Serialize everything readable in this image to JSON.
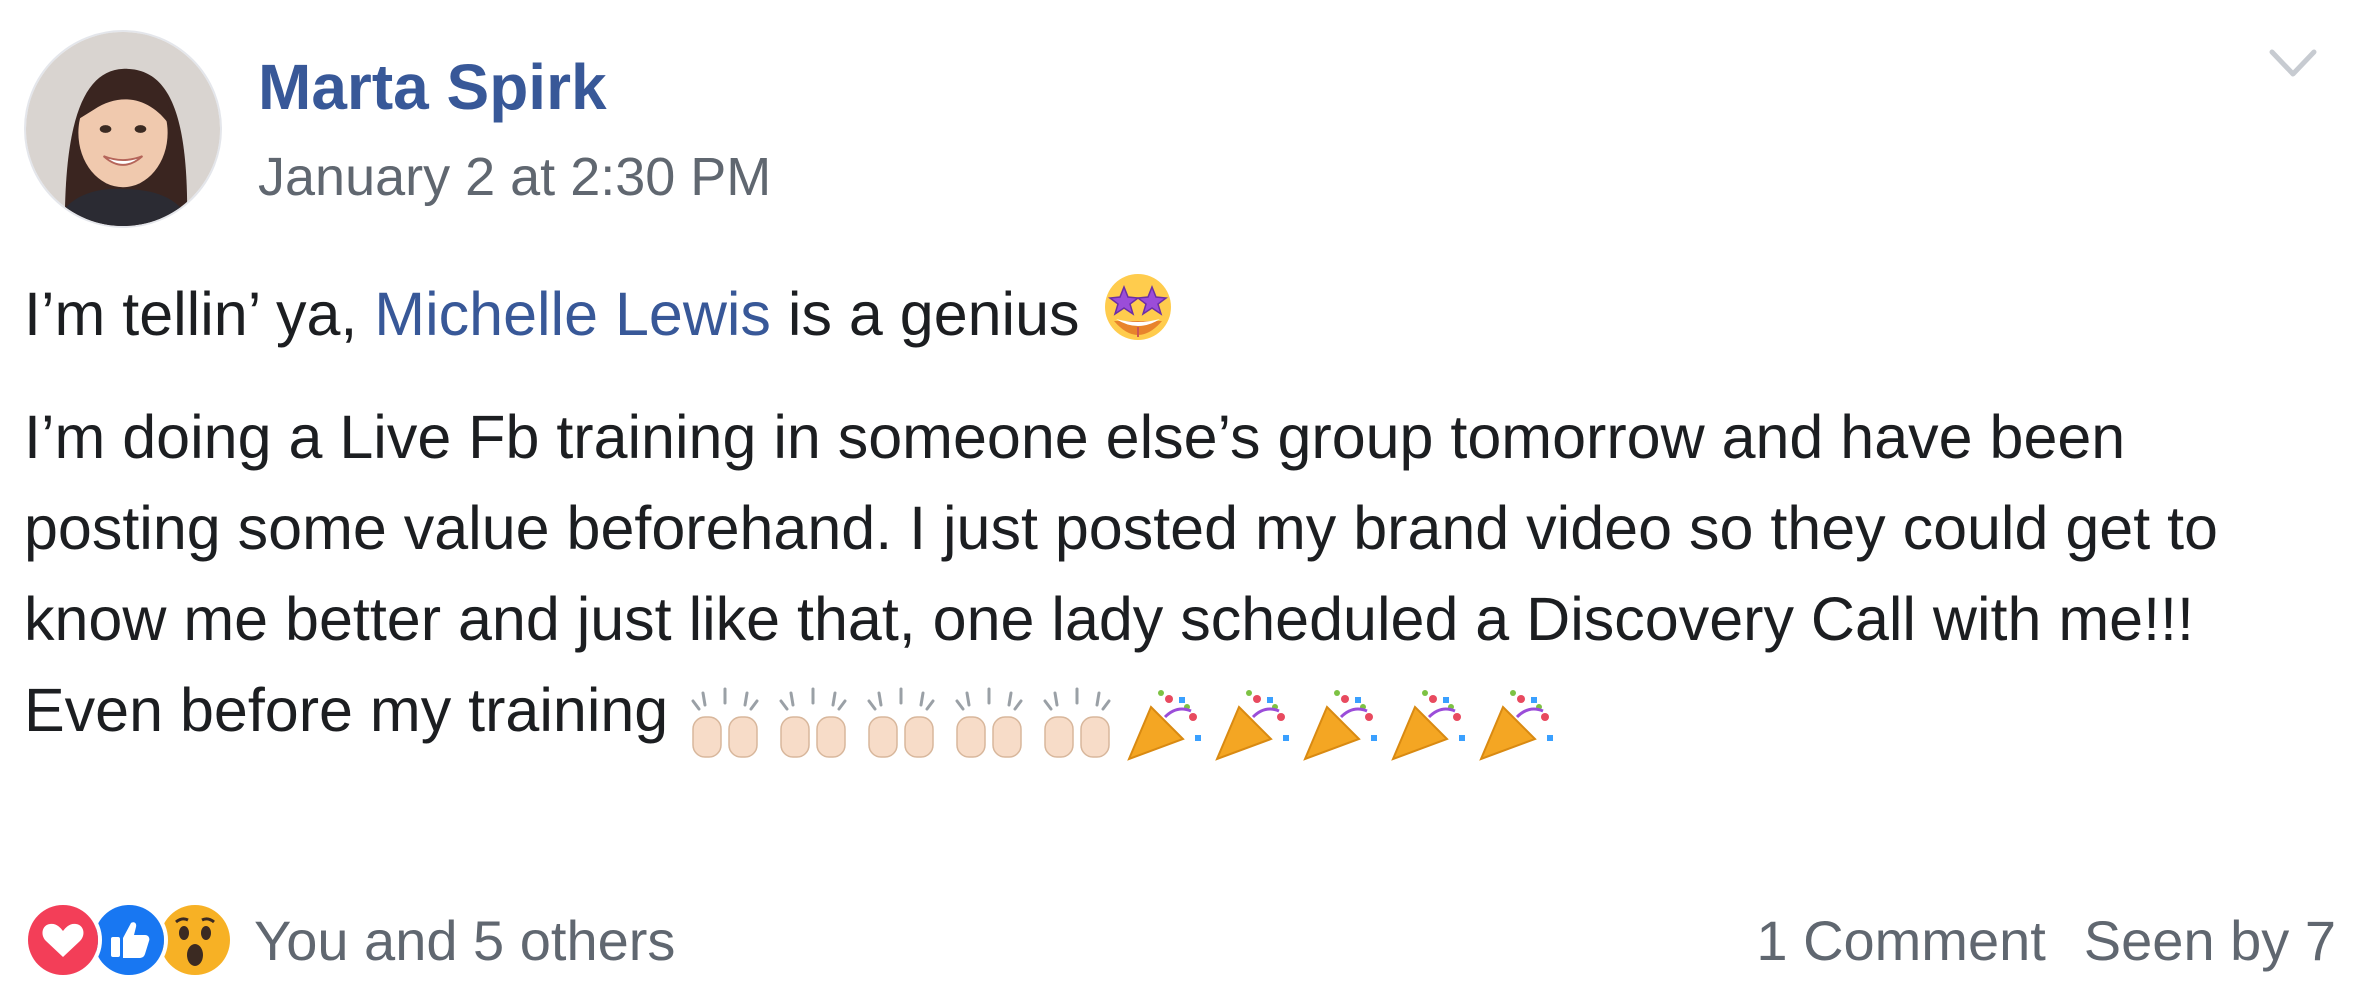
{
  "post": {
    "author": "Marta Spirk",
    "timestamp": "January 2 at 2:30 PM",
    "line1_prefix": "I’m tellin’ ya,",
    "mention": "Michelle Lewis",
    "line1_suffix": "is a genius",
    "line1_emoji": "star-struck-emoji",
    "body": "I’m doing a Live Fb training in someone else’s group tomorrow and have been posting some value beforehand. I just posted my brand video so they could get to know me better and just like that, one lady scheduled a Discovery Call with me!!! Even before my training",
    "trailing_emojis": [
      "raising-hands-emoji",
      "raising-hands-emoji",
      "raising-hands-emoji",
      "raising-hands-emoji",
      "raising-hands-emoji",
      "party-popper-emoji",
      "party-popper-emoji",
      "party-popper-emoji",
      "party-popper-emoji",
      "party-popper-emoji"
    ]
  },
  "footer": {
    "reaction_icons": [
      "love-reaction-icon",
      "like-reaction-icon",
      "wow-reaction-icon"
    ],
    "reactions_text": "You and 5 others",
    "comments": "1 Comment",
    "seen_by": "Seen by 7"
  },
  "colors": {
    "link": "#385898",
    "meta": "#606770",
    "text": "#1c1e21",
    "love": "#f33e58",
    "like": "#1877f2",
    "wow": "#f7b125"
  }
}
